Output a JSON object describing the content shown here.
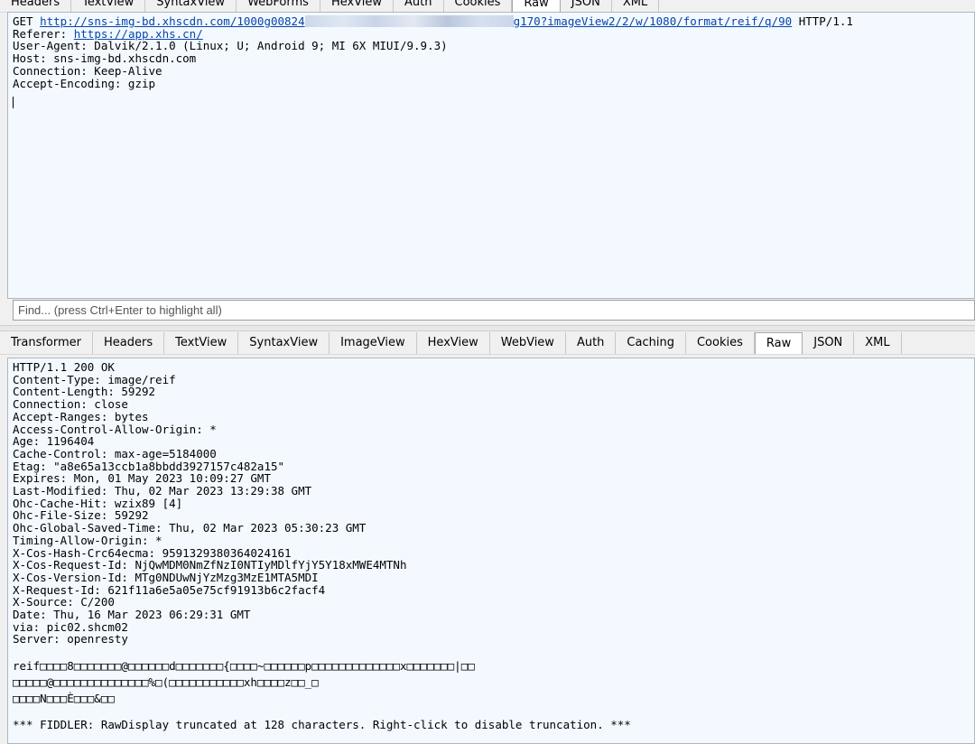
{
  "request_tabs": [
    "Headers",
    "TextView",
    "SyntaxView",
    "WebForms",
    "HexView",
    "Auth",
    "Cookies",
    "Raw",
    "JSON",
    "XML"
  ],
  "request_active_tab": "Raw",
  "request": {
    "method": "GET",
    "url_start": "http://sns-img-bd.xhscdn.com/1000g00824",
    "url_end": "g170?imageView2/2/w/1080/format/reif/q/90",
    "protocol": "HTTP/1.1",
    "referer_label": "Referer:",
    "referer_url": "https://app.xhs.cn/",
    "lines": [
      "User-Agent: Dalvik/2.1.0 (Linux; U; Android 9; MI 6X MIUI/9.9.3)",
      "Host: sns-img-bd.xhscdn.com",
      "Connection: Keep-Alive",
      "Accept-Encoding: gzip"
    ]
  },
  "find_bar": {
    "placeholder": "Find... (press Ctrl+Enter to highlight all)"
  },
  "response_tabs": [
    "Transformer",
    "Headers",
    "TextView",
    "SyntaxView",
    "ImageView",
    "HexView",
    "WebView",
    "Auth",
    "Caching",
    "Cookies",
    "Raw",
    "JSON",
    "XML"
  ],
  "response_active_tab": "Raw",
  "response": {
    "headers": [
      "HTTP/1.1 200 OK",
      "Content-Type: image/reif",
      "Content-Length: 59292",
      "Connection: close",
      "Accept-Ranges: bytes",
      "Access-Control-Allow-Origin: *",
      "Age: 1196404",
      "Cache-Control: max-age=5184000",
      "Etag: \"a8e65a13ccb1a8bbdd3927157c482a15\"",
      "Expires: Mon, 01 May 2023 10:09:27 GMT",
      "Last-Modified: Thu, 02 Mar 2023 13:29:38 GMT",
      "Ohc-Cache-Hit: wzix89 [4]",
      "Ohc-File-Size: 59292",
      "Ohc-Global-Saved-Time: Thu, 02 Mar 2023 05:30:23 GMT",
      "Timing-Allow-Origin: *",
      "X-Cos-Hash-Crc64ecma: 9591329380364024161",
      "X-Cos-Request-Id: NjQwMDM0NmZfNzI0NTIyMDlfYjY5Y18xMWE4MTNh",
      "X-Cos-Version-Id: MTg0NDUwNjYzMzg3MzE1MTA5MDI",
      "X-Request-Id: 621f11a6e5a05e75cf91913b6c2facf4",
      "X-Source: C/200",
      "Date: Thu, 16 Mar 2023 06:29:31 GMT",
      "via: pic02.shcm02",
      "Server: openresty"
    ],
    "body_lines": [
      "reif□□□□8□□□□□□□@□□□□□□d□□□□□□□{□□□□~□□□□□□p□□□□□□□□□□□□□x□□□□□□□|□□",
      "□□□□□@□□□□□□□□□□□□□□%□(□□□□□□□□□□□xh□□□□z□□_□",
      "□□□□N□□□È□□□&□□"
    ],
    "truncation_notice": "*** FIDDLER: RawDisplay truncated at 128 characters. Right-click to disable truncation. ***"
  }
}
